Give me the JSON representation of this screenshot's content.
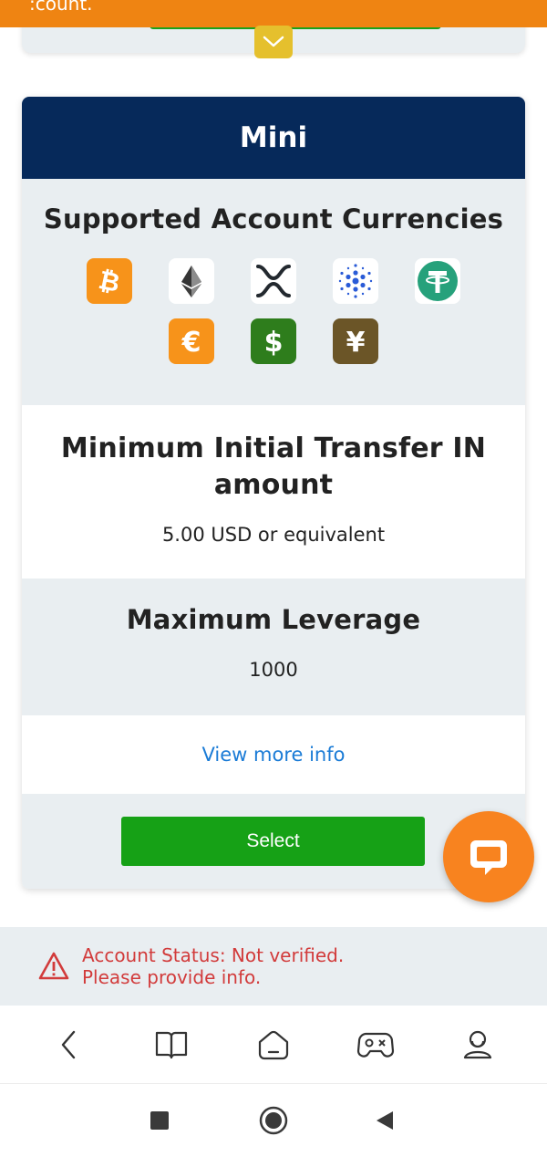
{
  "top_banner": {
    "text": ":count."
  },
  "plan": {
    "name": "Mini",
    "currencies_title": "Supported Account Currencies",
    "currency_icons": [
      {
        "name": "bitcoin-icon",
        "glyph": "₿",
        "bg": "#f7931a"
      },
      {
        "name": "ethereum-icon",
        "glyph": "",
        "bg": "#ffffff"
      },
      {
        "name": "xrp-icon",
        "glyph": "",
        "bg": "#ffffff"
      },
      {
        "name": "cardano-icon",
        "glyph": "",
        "bg": "#ffffff"
      },
      {
        "name": "tether-icon",
        "glyph": "T",
        "bg": "#26a17b"
      },
      {
        "name": "euro-icon",
        "glyph": "€",
        "bg": "#f7931a"
      },
      {
        "name": "dollar-icon",
        "glyph": "$",
        "bg": "#2e7d1c"
      },
      {
        "name": "yen-icon",
        "glyph": "¥",
        "bg": "#6b5527"
      }
    ],
    "min_transfer_title": "Minimum Initial Transfer IN amount",
    "min_transfer_value": "5.00 USD or equivalent",
    "max_leverage_title": "Maximum Leverage",
    "max_leverage_value": "1000",
    "more_info_label": "View more info",
    "select_label": "Select"
  },
  "account_status": {
    "line1": "Account Status: Not verified.",
    "line2": "Please provide info."
  },
  "colors": {
    "header": "#06295a",
    "section_bg": "#e9eef1",
    "select_green": "#16a116",
    "chat_orange": "#f8831f",
    "link_blue": "#1a7bd6",
    "status_red": "#d23b3b",
    "banner_orange": "#ef8412"
  },
  "bottom_nav": [
    "back-icon",
    "book-icon",
    "home-icon",
    "gamepad-icon",
    "profile-icon"
  ],
  "system_nav": [
    "recents-icon",
    "home-circle-icon",
    "back-triangle-icon"
  ]
}
